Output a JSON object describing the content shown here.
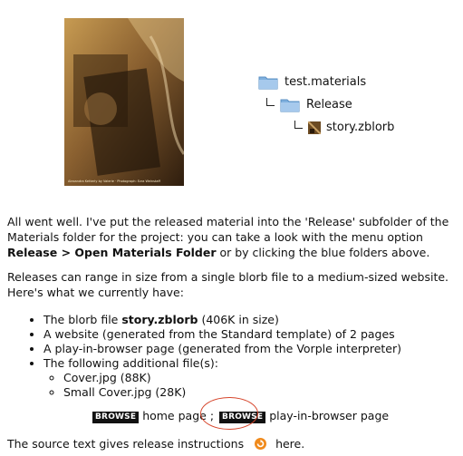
{
  "cover": {
    "credit": "Alexandra Ketterly by Valerie · Photograph: Ezra Weinstaff"
  },
  "tree": {
    "root_label": "test.materials",
    "release_label": "Release",
    "file_label": "story.zblorb"
  },
  "intro": {
    "text_before": "All went well. I've put the released material into the 'Release' subfolder of the Materials folder for the project: you can take a look with the menu option ",
    "menu_path": "Release > Open Materials Folder",
    "text_after": " or by clicking the blue folders above."
  },
  "summary": {
    "text": "Releases can range in size from a single blorb file to a medium-sized website. Here's what we currently have:"
  },
  "items": {
    "blorb_prefix": "The blorb file ",
    "blorb_name": "story.zblorb",
    "blorb_suffix": " (406K in size)",
    "website": "A website (generated from the Standard template) of 2 pages",
    "play_page": "A play-in-browser page (generated from the Vorple interpreter)",
    "additional": "The following additional file(s):",
    "files": [
      "Cover.jpg (88K)",
      "Small Cover.jpg (28K)"
    ]
  },
  "browse": {
    "button_label": "BROWSE",
    "home_label": "home page",
    "separator": ";",
    "play_label": "play-in-browser page"
  },
  "source": {
    "text": "The source text gives release instructions",
    "link": "here."
  },
  "colors": {
    "folder_blue": "#7fb0de",
    "highlight": "#d6462c",
    "arrow_orange": "#f08a1c"
  }
}
